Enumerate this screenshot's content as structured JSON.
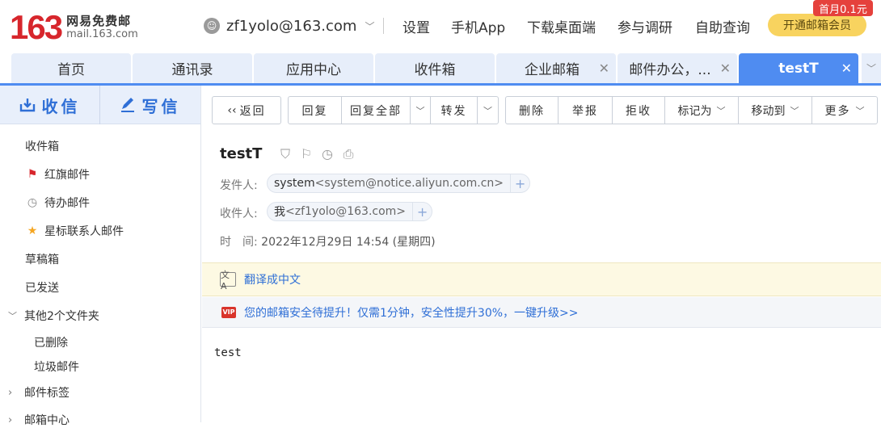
{
  "header": {
    "logo_number": "163",
    "logo_cn": "网易免费邮",
    "logo_en": "mail.163.com",
    "account": "zf1yolo@163.com",
    "nav": [
      "设置",
      "手机App",
      "下载桌面端",
      "参与调研",
      "自助查询"
    ],
    "vip_button": "开通邮箱会员",
    "vip_badge": "首月0.1元"
  },
  "tabs": [
    {
      "label": "首页"
    },
    {
      "label": "通讯录"
    },
    {
      "label": "应用中心"
    },
    {
      "label": "收件箱"
    },
    {
      "label": "企业邮箱"
    },
    {
      "label": "邮件办公，..."
    },
    {
      "label": "testT"
    }
  ],
  "sidebar": {
    "receive": "收信",
    "write": "写信",
    "folders": [
      {
        "label": "收件箱"
      },
      {
        "label": "红旗邮件"
      },
      {
        "label": "待办邮件"
      },
      {
        "label": "星标联系人邮件"
      },
      {
        "label": "草稿箱"
      },
      {
        "label": "已发送"
      },
      {
        "label": "其他2个文件夹"
      },
      {
        "label": "已删除"
      },
      {
        "label": "垃圾邮件"
      },
      {
        "label": "邮件标签"
      },
      {
        "label": "邮箱中心"
      }
    ]
  },
  "toolbar": {
    "back": "返回",
    "reply": "回复",
    "reply_all": "回复全部",
    "forward": "转发",
    "delete": "删除",
    "report": "举报",
    "reject": "拒收",
    "mark_as": "标记为",
    "move_to": "移动到",
    "more": "更多"
  },
  "message": {
    "subject": "testT",
    "from_label": "发件人:",
    "from_name": "system",
    "from_addr": "<system@notice.aliyun.com.cn>",
    "to_label": "收件人:",
    "to_name": "我",
    "to_addr": "<zf1yolo@163.com>",
    "time_label": "时　间:",
    "time_value": "2022年12月29日 14:54 (星期四)",
    "translate": "翻译成中文",
    "security_notice": "您的邮箱安全待提升！仅需1分钟，安全性提升30%，一键升级>>",
    "body": "test"
  }
}
